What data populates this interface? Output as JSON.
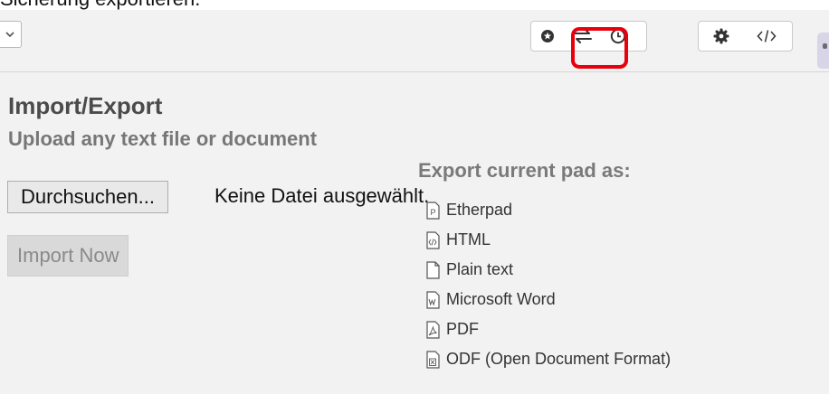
{
  "caption": {
    "text": "Sicherung exportieren."
  },
  "toolbar": {
    "dropdown_icon": "chevron-down-icon",
    "buttons": [
      {
        "icon": "star-icon",
        "name": "star"
      },
      {
        "icon": "import-export-icon",
        "name": "import-export"
      },
      {
        "icon": "clock-icon",
        "name": "history"
      },
      {
        "icon": "gear-icon",
        "name": "settings"
      },
      {
        "icon": "code-icon",
        "name": "embed"
      }
    ],
    "highlight_color": "#e8000d"
  },
  "import": {
    "title": "Import/Export",
    "subtitle": "Upload any text file or document",
    "browse_label": "Durchsuchen...",
    "no_file_label": "Keine Datei ausgewählt.",
    "import_label": "Import Now"
  },
  "export": {
    "heading": "Export current pad as:",
    "items": [
      {
        "label": "Etherpad",
        "icon": "etherpad-file-icon"
      },
      {
        "label": "HTML",
        "icon": "html-file-icon"
      },
      {
        "label": "Plain text",
        "icon": "text-file-icon"
      },
      {
        "label": "Microsoft Word",
        "icon": "word-file-icon"
      },
      {
        "label": "PDF",
        "icon": "pdf-file-icon"
      },
      {
        "label": "ODF (Open Document Format)",
        "icon": "odf-file-icon"
      }
    ]
  }
}
